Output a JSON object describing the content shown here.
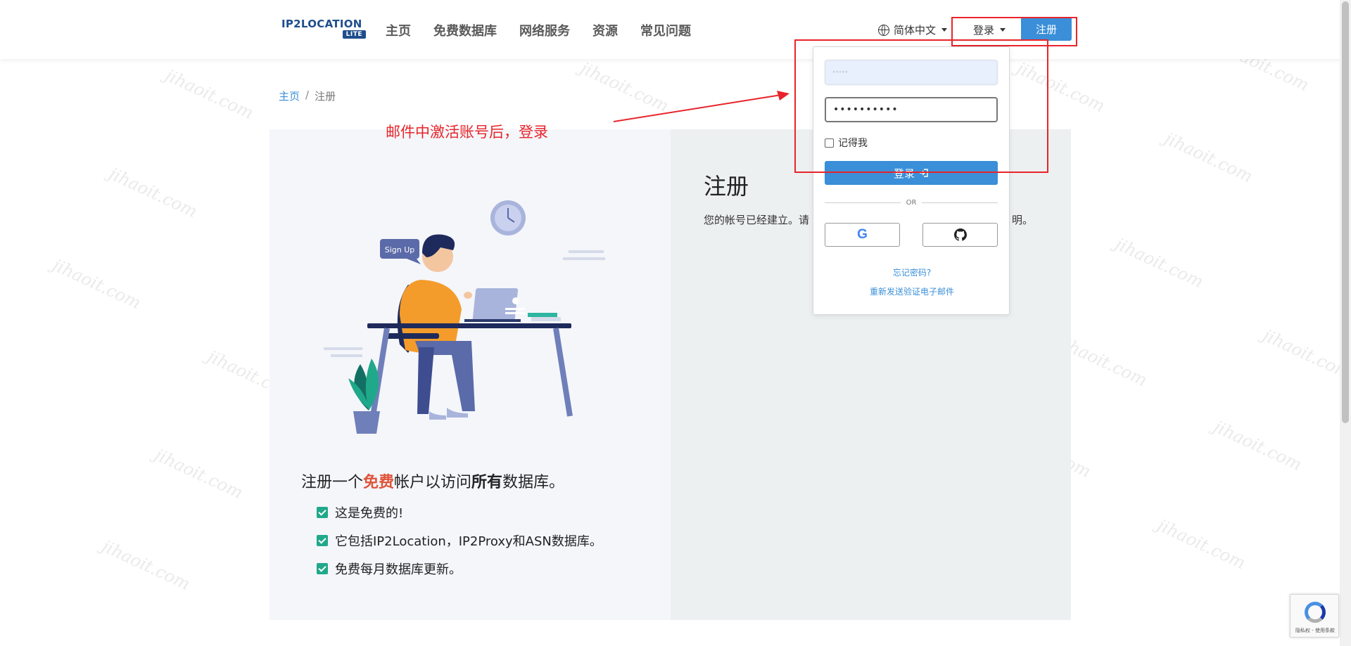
{
  "header": {
    "logo_text": "IP2LOCATION",
    "logo_badge": "LITE",
    "nav": [
      "主页",
      "免费数据库",
      "网络服务",
      "资源",
      "常见问题"
    ],
    "language": "简体中文",
    "login_label": "登录",
    "signup_label": "注册"
  },
  "breadcrumb": {
    "home": "主页",
    "separator": "/",
    "current": "注册"
  },
  "annotation": {
    "text": "邮件中激活账号后，登录",
    "color": "#e8242a"
  },
  "left_panel": {
    "illustration_bubble": "Sign Up",
    "pitch_prefix": "注册一个",
    "pitch_free": "免费",
    "pitch_mid": "帐户以访问",
    "pitch_all": "所有",
    "pitch_suffix": "数据库。",
    "features": [
      "这是免费的!",
      "它包括IP2Location，IP2Proxy和ASN数据库。",
      "免费每月数据库更新。"
    ]
  },
  "right_panel": {
    "title": "注册",
    "message_start": "您的帐号已经建立。请",
    "message_end": "明。"
  },
  "login_popover": {
    "email_value": "·····",
    "password_value": "••••••••••",
    "remember_label": "记得我",
    "submit_label": "登录",
    "or_label": "OR",
    "google_icon": "G",
    "forgot_link": "忘记密码?",
    "resend_link": "重新发送验证电子邮件"
  },
  "recaptcha": {
    "text": "隐私权 - 使用条款"
  },
  "watermark": "jihaoit.com",
  "colors": {
    "primary": "#3a8fd8",
    "annotation_red": "#e8242a",
    "accent_orange": "#e0533a",
    "check_green": "#20a88a"
  }
}
